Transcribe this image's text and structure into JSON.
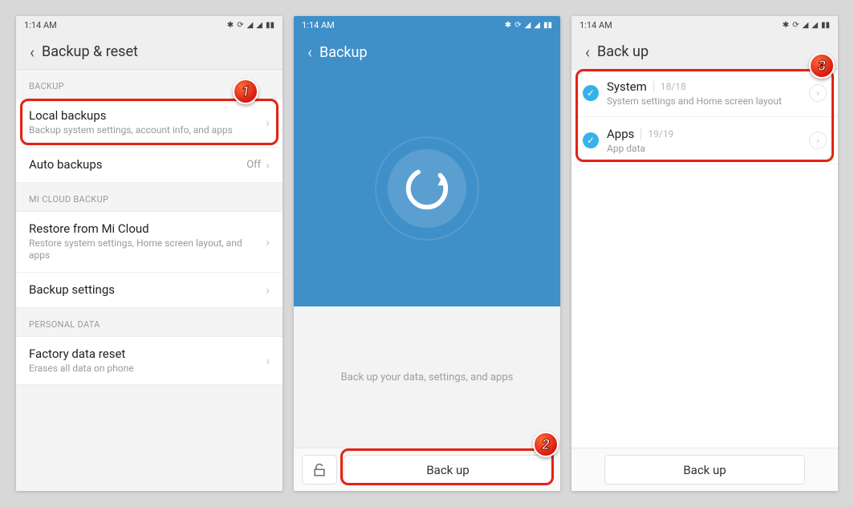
{
  "statusbar": {
    "time": "1:14  AM"
  },
  "screen1": {
    "title": "Backup & reset",
    "sections": {
      "backup_header": "BACKUP",
      "local_backups": {
        "title": "Local backups",
        "sub": "Backup system settings, account info, and apps"
      },
      "auto_backups": {
        "title": "Auto backups",
        "value": "Off"
      },
      "micloud_header": "MI CLOUD BACKUP",
      "restore": {
        "title": "Restore from Mi Cloud",
        "sub": "Restore system settings, Home screen layout, and apps"
      },
      "backup_settings": {
        "title": "Backup settings"
      },
      "personal_header": "PERSONAL DATA",
      "factory": {
        "title": "Factory data reset",
        "sub": "Erases all data on phone"
      }
    }
  },
  "screen2": {
    "title": "Backup",
    "hint": "Back up your data, settings, and apps",
    "button": "Back up"
  },
  "screen3": {
    "title": "Back up",
    "system": {
      "title": "System",
      "count": "18/18",
      "sub": "System settings and Home screen layout"
    },
    "apps": {
      "title": "Apps",
      "count": "19/19",
      "sub": "App data"
    },
    "button": "Back up"
  },
  "badges": {
    "b1": "1",
    "b2": "2",
    "b3": "3"
  }
}
